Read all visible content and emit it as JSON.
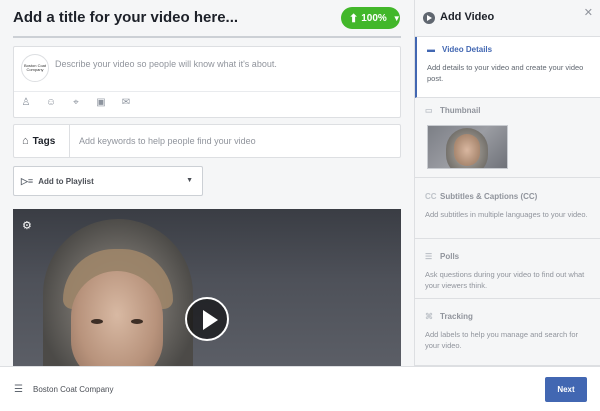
{
  "composer": {
    "title_placeholder": "Add a title for your video here...",
    "upload": {
      "progress_label": "100%",
      "progress": 1.0,
      "icon": "upload-arrow-icon"
    },
    "description": {
      "avatar_text": "Boston Coat Company",
      "placeholder": "Describe your video so people will know what it's about.",
      "icons": [
        "tag-people-icon",
        "emoji-icon",
        "location-icon",
        "sticker-icon",
        "messenger-icon"
      ]
    },
    "tags": {
      "label": "Tags",
      "placeholder": "Add keywords to help people find your video"
    },
    "playlist": {
      "label": "Add to Playlist"
    }
  },
  "sidebar": {
    "title": "Add Video",
    "sections": [
      {
        "title": "Video Details",
        "body": "Add details to your video and create your video post.",
        "active": true,
        "icon": "video-details-icon"
      },
      {
        "title": "Thumbnail",
        "body": "",
        "active": false,
        "icon": "thumbnail-icon"
      },
      {
        "title": "Subtitles & Captions (CC)",
        "body": "Add subtitles in multiple languages to your video.",
        "active": false,
        "icon": "captions-icon"
      },
      {
        "title": "Polls",
        "body": "Ask questions during your video to find out what your viewers think.",
        "active": false,
        "icon": "polls-icon"
      },
      {
        "title": "Tracking",
        "body": "Add labels to help you manage and search for your video.",
        "active": false,
        "icon": "tracking-icon"
      }
    ]
  },
  "footer": {
    "page_name": "Boston Coat Company",
    "next_label": "Next"
  },
  "colors": {
    "accent": "#4267b2",
    "upload_green": "#42b72a"
  }
}
